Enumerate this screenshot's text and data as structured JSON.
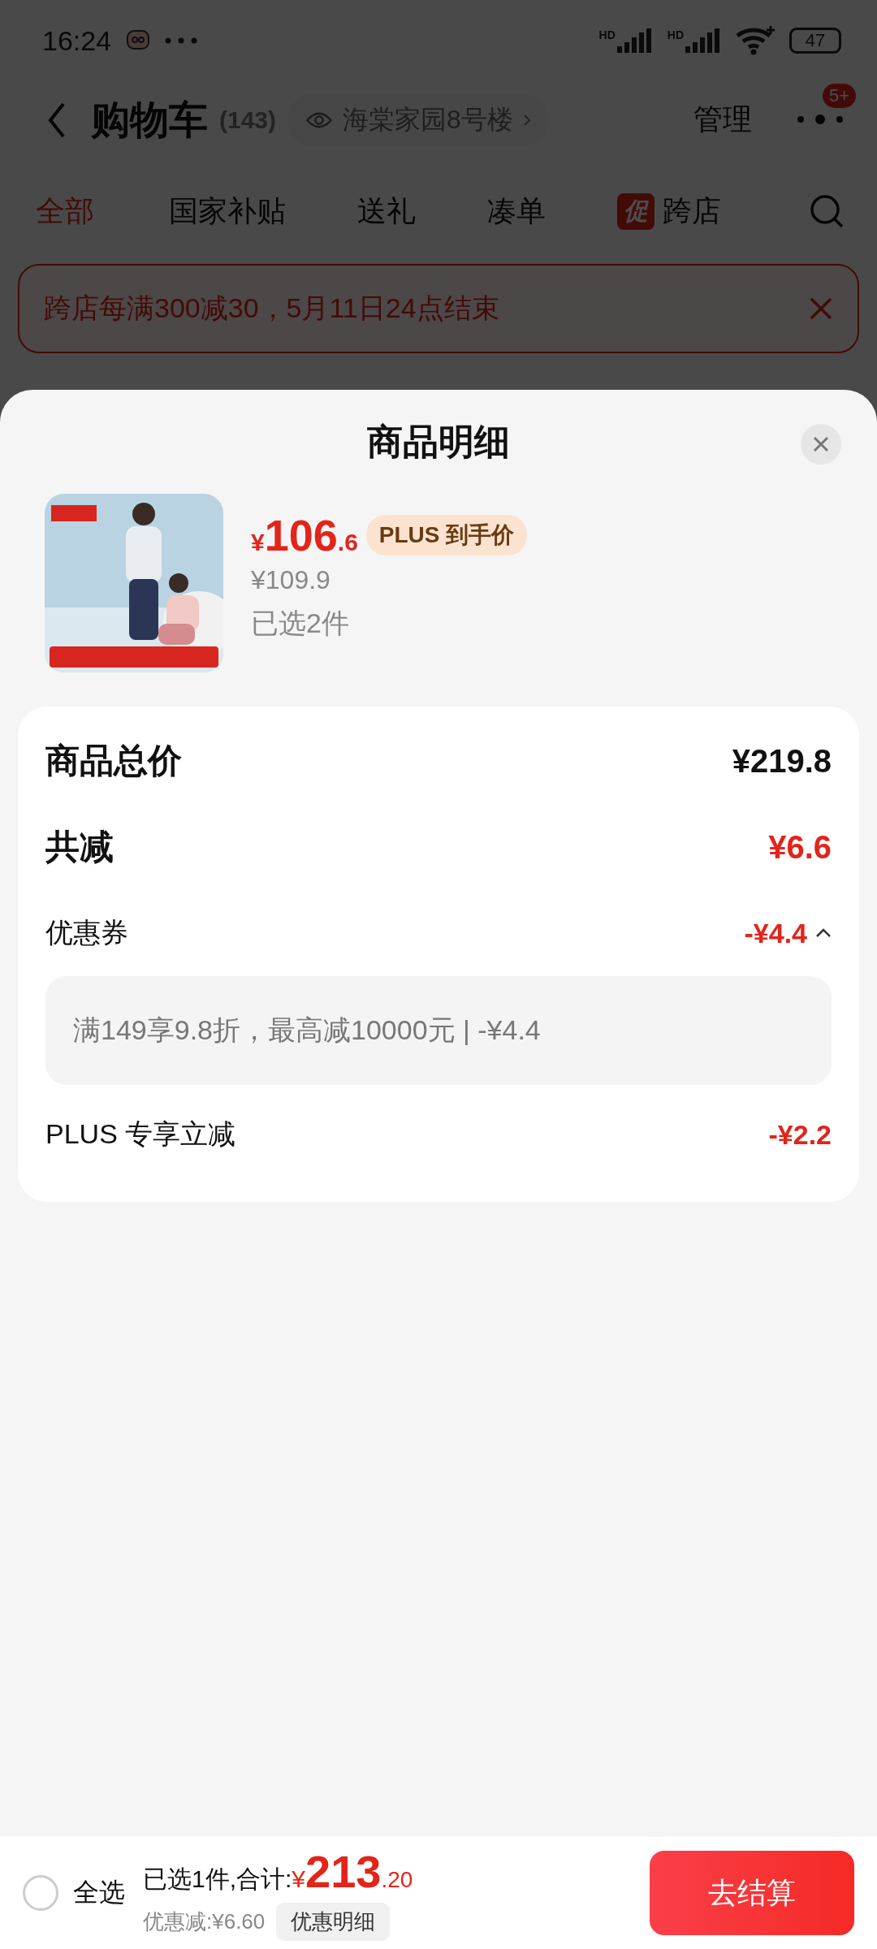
{
  "status_bar": {
    "time": "16:24",
    "signals": [
      {
        "label": "HD"
      },
      {
        "label": "HD"
      }
    ],
    "battery": "47"
  },
  "header": {
    "title": "购物车",
    "count": "(143)",
    "address": "海棠家园8号楼",
    "manage": "管理",
    "more_badge": "5+"
  },
  "tabs": [
    {
      "label": "全部",
      "selected": true
    },
    {
      "label": "国家补贴",
      "selected": false
    },
    {
      "label": "送礼",
      "selected": false
    },
    {
      "label": "凑单",
      "selected": false
    },
    {
      "label": "跨店",
      "selected": false,
      "badge": "促"
    }
  ],
  "promo_banner": {
    "text": "跨店每满300减30，5月11日24点结束"
  },
  "sheet": {
    "title": "商品明细",
    "product": {
      "price_currency": "¥",
      "price_integer": "106",
      "price_decimal": ".6",
      "price_tag": "PLUS 到手价",
      "original_price": "¥109.9",
      "quantity": "已选2件"
    },
    "summary": [
      {
        "kind": "total",
        "label": "商品总价",
        "value": "¥219.8"
      },
      {
        "kind": "reduction",
        "label": "共减",
        "value": "¥6.6"
      },
      {
        "kind": "coupon",
        "label": "优惠券",
        "value": "-¥4.4",
        "expanded": true,
        "detail": "满149享9.8折，最高减10000元 | -¥4.4"
      },
      {
        "kind": "discount",
        "label": "PLUS 专享立减",
        "value": "-¥2.2"
      }
    ]
  },
  "bottom_bar": {
    "select_all": {
      "label": "全选",
      "checked": false
    },
    "selected_text": "已选1件,合计:",
    "total_currency": "¥",
    "total_integer": "213",
    "total_decimal": ".20",
    "saving": "优惠减:¥6.60",
    "details_button": "优惠明细",
    "checkout_button": "去结算"
  }
}
